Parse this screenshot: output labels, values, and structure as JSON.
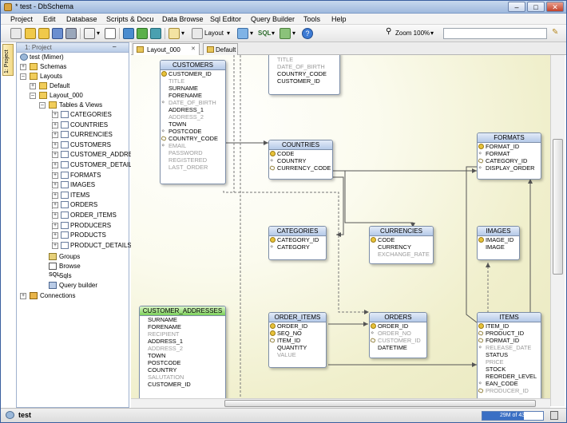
{
  "window": {
    "title": "* test - DbSchema"
  },
  "menu": [
    "Project",
    "Edit",
    "Database",
    "Scripts & Docu",
    "Data Browse",
    "Sql Editor",
    "Query Builder",
    "Tools",
    "Help"
  ],
  "toolbar": {
    "layout_label": "Layout",
    "zoom_label": "Zoom 100%",
    "search_placeholder": ""
  },
  "side_tab": "1: Project",
  "project_panel": {
    "header": "1: Project",
    "root": "test (Mimer)",
    "schemas": "Schemas",
    "layouts": "Layouts",
    "default_layout": "Default",
    "layout_000": "Layout_000",
    "tables_views": "Tables & Views",
    "tables": [
      "CATEGORIES",
      "COUNTRIES",
      "CURRENCIES",
      "CUSTOMERS",
      "CUSTOMER_ADDRESSES",
      "CUSTOMER_DETAILS",
      "FORMATS",
      "IMAGES",
      "ITEMS",
      "ORDERS",
      "ORDER_ITEMS",
      "PRODUCERS",
      "PRODUCTS",
      "PRODUCT_DETAILS"
    ],
    "groups": "Groups",
    "browse": "Browse",
    "sqls": "Sqls",
    "sql_prefix": "SQL",
    "query_builder": "Query builder",
    "connections": "Connections"
  },
  "tabs": [
    {
      "label": "Layout_000"
    },
    {
      "label": "Default"
    }
  ],
  "diagram": {
    "customers": {
      "name": "CUSTOMERS",
      "columns": [
        {
          "n": "CUSTOMER_ID",
          "k": "pk"
        },
        {
          "n": "TITLE",
          "k": "",
          "g": true
        },
        {
          "n": "SURNAME",
          "k": ""
        },
        {
          "n": "FORENAME",
          "k": ""
        },
        {
          "n": "DATE_OF_BIRTH",
          "k": "idx",
          "g": true
        },
        {
          "n": "ADDRESS_1",
          "k": ""
        },
        {
          "n": "ADDRESS_2",
          "k": "",
          "g": true
        },
        {
          "n": "TOWN",
          "k": ""
        },
        {
          "n": "POSTCODE",
          "k": "idx"
        },
        {
          "n": "COUNTRY_CODE",
          "k": "fk"
        },
        {
          "n": "EMAIL",
          "k": "idx",
          "g": true
        },
        {
          "n": "PASSWORD",
          "k": "",
          "g": true
        },
        {
          "n": "REGISTERED",
          "k": "",
          "g": true
        },
        {
          "n": "LAST_ORDER",
          "k": "",
          "g": true
        }
      ]
    },
    "customer_details": {
      "name": "",
      "columns": [
        {
          "n": "TITLE",
          "k": "",
          "g": true
        },
        {
          "n": "DATE_OF_BIRTH",
          "k": "",
          "g": true
        },
        {
          "n": "COUNTRY_CODE",
          "k": ""
        },
        {
          "n": "CUSTOMER_ID",
          "k": ""
        }
      ]
    },
    "countries": {
      "name": "COUNTRIES",
      "columns": [
        {
          "n": "CODE",
          "k": "pk"
        },
        {
          "n": "COUNTRY",
          "k": "idx"
        },
        {
          "n": "CURRENCY_CODE",
          "k": "fk"
        }
      ]
    },
    "formats": {
      "name": "FORMATS",
      "columns": [
        {
          "n": "FORMAT_ID",
          "k": "pk"
        },
        {
          "n": "FORMAT",
          "k": "idx"
        },
        {
          "n": "CATEGORY_ID",
          "k": "fk"
        },
        {
          "n": "DISPLAY_ORDER",
          "k": "idx"
        }
      ]
    },
    "categories": {
      "name": "CATEGORIES",
      "columns": [
        {
          "n": "CATEGORY_ID",
          "k": "pk"
        },
        {
          "n": "CATEGORY",
          "k": "idx"
        }
      ]
    },
    "currencies": {
      "name": "CURRENCIES",
      "columns": [
        {
          "n": "CODE",
          "k": "pk"
        },
        {
          "n": "CURRENCY",
          "k": ""
        },
        {
          "n": "EXCHANGE_RATE",
          "k": "",
          "g": true
        }
      ]
    },
    "images": {
      "name": "IMAGES",
      "columns": [
        {
          "n": "IMAGE_ID",
          "k": "pk"
        },
        {
          "n": "IMAGE",
          "k": ""
        }
      ]
    },
    "customer_addresses": {
      "name": "CUSTOMER_ADDRESSES",
      "columns": [
        {
          "n": "SURNAME",
          "k": ""
        },
        {
          "n": "FORENAME",
          "k": ""
        },
        {
          "n": "RECIPIENT",
          "k": "",
          "g": true
        },
        {
          "n": "ADDRESS_1",
          "k": ""
        },
        {
          "n": "ADDRESS_2",
          "k": "",
          "g": true
        },
        {
          "n": "TOWN",
          "k": ""
        },
        {
          "n": "POSTCODE",
          "k": ""
        },
        {
          "n": "COUNTRY",
          "k": ""
        },
        {
          "n": "SALUTATION",
          "k": "",
          "g": true
        },
        {
          "n": "CUSTOMER_ID",
          "k": ""
        }
      ]
    },
    "order_items": {
      "name": "ORDER_ITEMS",
      "columns": [
        {
          "n": "ORDER_ID",
          "k": "pk"
        },
        {
          "n": "SEQ_NO",
          "k": "pk"
        },
        {
          "n": "ITEM_ID",
          "k": "fk"
        },
        {
          "n": "QUANTITY",
          "k": ""
        },
        {
          "n": "VALUE",
          "k": "",
          "g": true
        }
      ]
    },
    "orders": {
      "name": "ORDERS",
      "columns": [
        {
          "n": "ORDER_ID",
          "k": "pk"
        },
        {
          "n": "ORDER_NO",
          "k": "idx",
          "g": true
        },
        {
          "n": "CUSTOMER_ID",
          "k": "fk",
          "g": true
        },
        {
          "n": "DATETIME",
          "k": ""
        }
      ]
    },
    "items": {
      "name": "ITEMS",
      "columns": [
        {
          "n": "ITEM_ID",
          "k": "pk"
        },
        {
          "n": "PRODUCT_ID",
          "k": "fk"
        },
        {
          "n": "FORMAT_ID",
          "k": "fk"
        },
        {
          "n": "RELEASE_DATE",
          "k": "idx",
          "g": true
        },
        {
          "n": "STATUS",
          "k": ""
        },
        {
          "n": "PRICE",
          "k": "",
          "g": true
        },
        {
          "n": "STOCK",
          "k": ""
        },
        {
          "n": "REORDER_LEVEL",
          "k": ""
        },
        {
          "n": "EAN_CODE",
          "k": "idx"
        },
        {
          "n": "PRODUCER_ID",
          "k": "fk",
          "g": true
        }
      ]
    }
  },
  "status": {
    "project": "test",
    "memory": "29M of 43M"
  },
  "colors": {
    "accent": "#3a6fc4",
    "table_header": "#b5c9e8",
    "table_header_green": "#7bd05a",
    "canvas": "#f0efcc"
  }
}
